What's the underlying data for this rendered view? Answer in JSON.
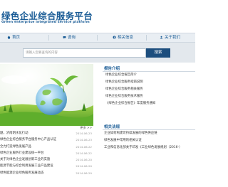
{
  "header": {
    "title": "绿色企业综合服务平台",
    "subtitle": "Green enterprise integrated service platform"
  },
  "nav": {
    "items": [
      {
        "label": "首页",
        "icon": "home-icon"
      },
      {
        "label": "咨询",
        "icon": "chat-icon"
      },
      {
        "label": "相关信息",
        "icon": "info-icon"
      },
      {
        "label": "关于我们",
        "icon": "about-icon"
      }
    ]
  },
  "search": {
    "placeholder": "请输入您要查询的内容",
    "button_label": "搜索"
  },
  "news": {
    "more_label": "更多 >>",
    "items": [
      {
        "title": "题，济南明水化行动",
        "date": "2014-06-23"
      },
      {
        "title": "绿色企业综合服务平台服务中心产品认证",
        "date": "2014-06-23"
      },
      {
        "title": "全力打造绿色发展产品",
        "date": "2014-06-22"
      },
      {
        "title": "绿色企业服务行业建设统一平台",
        "date": "2014-06-22"
      },
      {
        "title": "关于对绿色企业发展创新工业的实施",
        "date": "2014-06-20"
      },
      {
        "title": "能源节能与综合利用发展工业产品建设",
        "date": "2014-06-20"
      },
      {
        "title": "绿色能源企业绿色服务发展动态",
        "date": "2014-06-20"
      }
    ]
  },
  "panels": {
    "intro": {
      "title": "报告介绍",
      "items": [
        "绿色企业综合报告简介",
        "绿色企业综合服务指南说明",
        "绿色企业综合服务相关服务",
        "绿色企业综合服务技术服务",
        "《绿色企业综合报告》年度服务通知"
      ]
    },
    "links": {
      "title": "相关法规",
      "items": [
        "企业如何构建可持续发展的绿色供应链",
        "绿色发展中常用的相关认证",
        "工业和信息化部关于印发《工业绿色发展规划（2016-）"
      ]
    }
  }
}
